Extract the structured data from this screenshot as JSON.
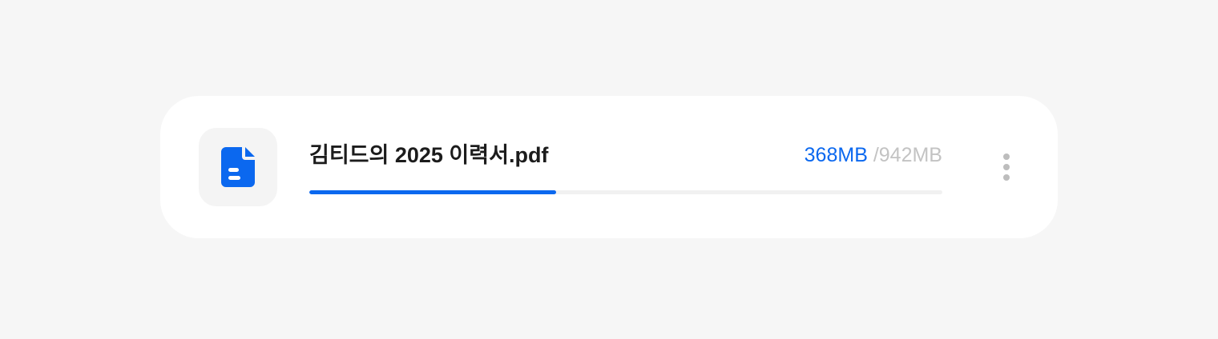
{
  "file": {
    "icon": "document-icon",
    "name": "김티드의 2025 이력서.pdf",
    "uploaded": "368MB",
    "total": "/942MB",
    "progress": 0.39
  },
  "colors": {
    "accent": "#0b68ef",
    "muted": "#c3c3c3",
    "track": "#f1f1f1"
  },
  "menu": {
    "icon": "more-vertical-icon"
  }
}
